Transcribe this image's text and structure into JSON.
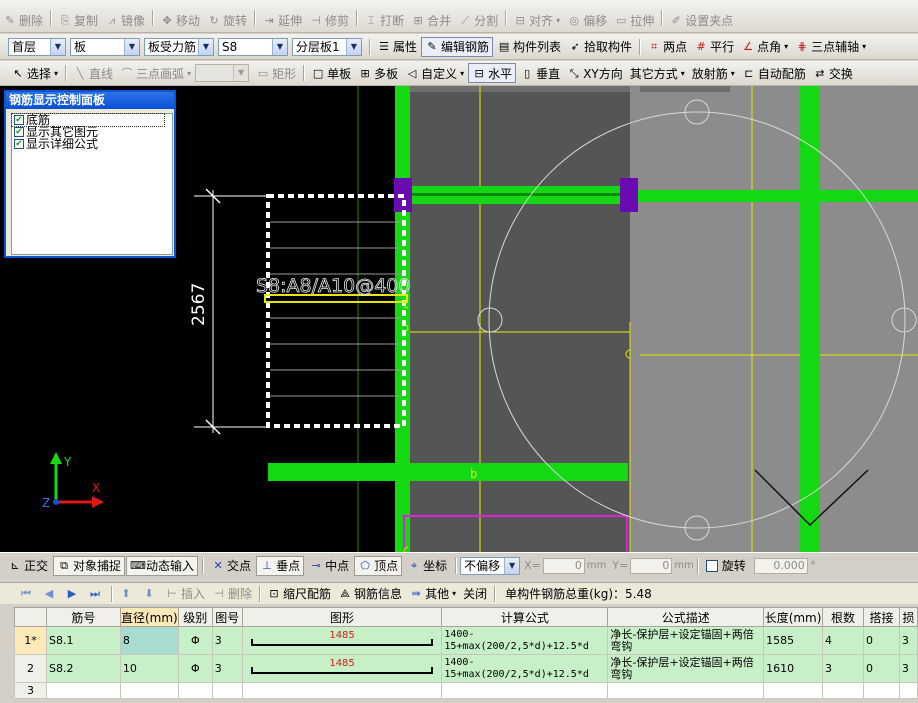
{
  "toolbar1": {
    "items": [
      {
        "label": "删除",
        "icon": "✎",
        "enabled": false
      },
      {
        "label": "复制",
        "icon": "⎘",
        "enabled": false
      },
      {
        "label": "镜像",
        "icon": "⩘",
        "enabled": false
      },
      {
        "label": "移动",
        "icon": "✥",
        "enabled": false
      },
      {
        "label": "旋转",
        "icon": "↻",
        "enabled": false
      },
      {
        "label": "延伸",
        "icon": "⇥",
        "enabled": false
      },
      {
        "label": "修剪",
        "icon": "⊣",
        "enabled": false
      },
      {
        "label": "打断",
        "icon": "⌶",
        "enabled": false
      },
      {
        "label": "合并",
        "icon": "⊞",
        "enabled": false
      },
      {
        "label": "分割",
        "icon": "⟋",
        "enabled": false
      },
      {
        "label": "对齐",
        "icon": "⊟",
        "enabled": false
      },
      {
        "label": "偏移",
        "icon": "◎",
        "enabled": false
      },
      {
        "label": "拉伸",
        "icon": "▭",
        "enabled": false
      },
      {
        "label": "设置夹点",
        "icon": "✐",
        "enabled": false
      }
    ]
  },
  "toolbar2": {
    "floor": "首层",
    "category": "板",
    "subcategory": "板受力筋",
    "element": "S8",
    "layer": "分层板1",
    "buttons": [
      {
        "label": "属性",
        "icon": "☰"
      },
      {
        "label": "编辑钢筋",
        "icon": "✎"
      },
      {
        "label": "构件列表",
        "icon": "▤"
      },
      {
        "label": "拾取构件",
        "icon": "➶"
      },
      {
        "label": "两点",
        "icon": "⌗"
      },
      {
        "label": "平行",
        "icon": "#"
      },
      {
        "label": "点角",
        "icon": "∠"
      },
      {
        "label": "三点辅轴",
        "icon": "⋕"
      }
    ]
  },
  "toolbar3": {
    "select_label": "选择",
    "line_label": "直线",
    "arc_label": "三点画弧",
    "rect_label": "矩形",
    "buttons": [
      {
        "label": "单板",
        "icon": "□"
      },
      {
        "label": "多板",
        "icon": "⊞"
      },
      {
        "label": "自定义",
        "icon": "◁"
      },
      {
        "label": "水平",
        "icon": "⊟"
      },
      {
        "label": "垂直",
        "icon": "▯"
      },
      {
        "label": "XY方向",
        "icon": "⤡"
      },
      {
        "label": "其它方式",
        "icon": ""
      },
      {
        "label": "放射筋",
        "icon": ""
      },
      {
        "label": "自动配筋",
        "icon": "⊏"
      },
      {
        "label": "交换",
        "icon": "⇄"
      }
    ]
  },
  "control_panel": {
    "title": "钢筋显示控制面板",
    "options": [
      {
        "label": "底筋",
        "checked": true
      },
      {
        "label": "显示其它图元",
        "checked": true
      },
      {
        "label": "显示详细公式",
        "checked": true
      }
    ]
  },
  "drawing": {
    "rebar_label": "S8:A8/A10@400",
    "dimension": "2567",
    "axis_y": "Y",
    "axis_x": "X",
    "axis_z": "Z",
    "marker_b": "b"
  },
  "statusbar": {
    "ortho": "正交",
    "snap": "对象捕捉",
    "dyn_input": "动态输入",
    "intersection": "交点",
    "perpendicular": "垂点",
    "midpoint": "中点",
    "vertex": "顶点",
    "coordinate": "坐标",
    "offset_mode": "不偏移",
    "x_label": "X=",
    "x_value": "0",
    "y_label": "Y=",
    "y_value": "0",
    "unit": "mm",
    "rotate_label": "旋转",
    "rotate_value": "0.000",
    "degree": "°"
  },
  "grid_toolbar": {
    "insert": "插入",
    "delete": "删除",
    "scale_rebar": "缩尺配筋",
    "rebar_info": "钢筋信息",
    "other": "其他",
    "close": "关闭",
    "total_label": "单构件钢筋总重(kg)：5.48"
  },
  "grid": {
    "headers": [
      "",
      "筋号",
      "直径(mm)",
      "级别",
      "图号",
      "图形",
      "计算公式",
      "公式描述",
      "长度(mm)",
      "根数",
      "搭接",
      "损"
    ],
    "rows": [
      {
        "index": "1*",
        "name": "S8.1",
        "diameter": "8",
        "grade": "Φ",
        "fig": "3",
        "shape_value": "1485",
        "formula": "1400-15+max(200/2,5*d)+12.5*d",
        "description": "净长-保护层+设定锚固+两倍弯钩",
        "length": "1585",
        "count": "4",
        "lap": "0",
        "loss": "3"
      },
      {
        "index": "2",
        "name": "S8.2",
        "diameter": "10",
        "grade": "Φ",
        "fig": "3",
        "shape_value": "1485",
        "formula": "1400-15+max(200/2,5*d)+12.5*d",
        "description": "净长-保护层+设定锚固+两倍弯钩",
        "length": "1610",
        "count": "3",
        "lap": "0",
        "loss": "3"
      }
    ],
    "empty_row_index": "3"
  }
}
